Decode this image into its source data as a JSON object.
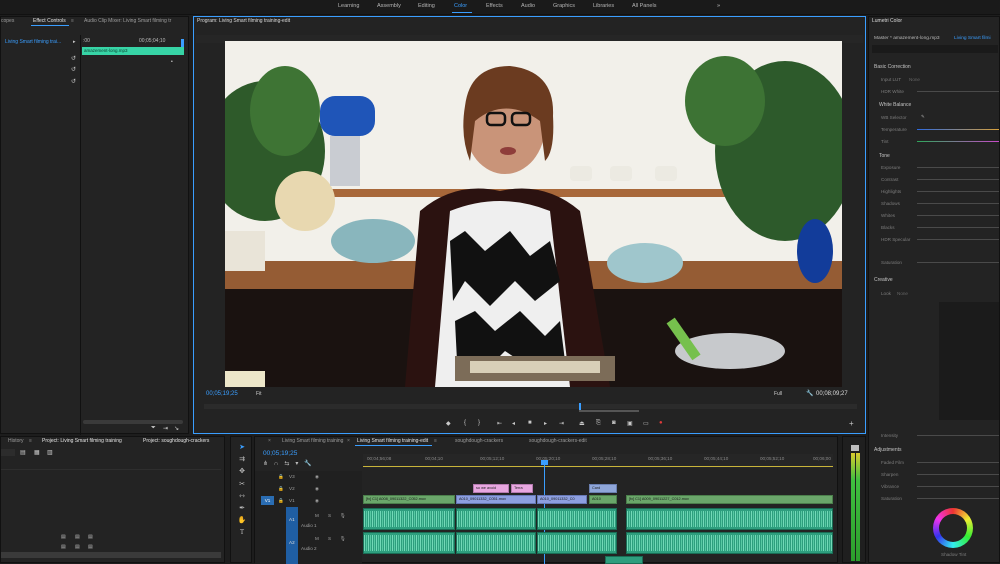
{
  "workspaces": [
    {
      "label": "Learning"
    },
    {
      "label": "Assembly"
    },
    {
      "label": "Editing"
    },
    {
      "label": "Color"
    },
    {
      "label": "Effects"
    },
    {
      "label": "Audio"
    },
    {
      "label": "Graphics"
    },
    {
      "label": "Libraries"
    },
    {
      "label": "All Panels"
    }
  ],
  "left_panel": {
    "tabs": [
      "copes",
      "Effect Controls",
      "Audio Clip Mixer: Living Smart filming tr"
    ],
    "clip_name": "Living Smart filming trai...",
    "mini_time_start": ":00",
    "mini_time_end": "00;05;04;10",
    "mini_clip": "amazement-long.mp3"
  },
  "program": {
    "title": "Program: Living Smart filming training-edit",
    "timecode": "00;05;19;25",
    "fit": "Fit",
    "quality": "Full",
    "duration": "00;08;09;27"
  },
  "lumetri": {
    "title": "Lumetri Color",
    "master": "Master * amazement-long.mp3",
    "clip": "Living Smart filmi",
    "basic": "Basic Correction",
    "input_lut": "Input LUT",
    "input_lut_val": "None",
    "hdr_white": "HDR White",
    "white_balance": "White Balance",
    "wb_selector": "WB Selector",
    "temperature": "Temperature",
    "tint": "Tint",
    "tone": "Tone",
    "exposure": "Exposure",
    "contrast": "Contrast",
    "highlights": "Highlights",
    "shadows": "Shadows",
    "whites": "Whites",
    "blacks": "Blacks",
    "hdr_specular": "HDR Specular",
    "saturation": "Saturation",
    "creative": "Creative",
    "look": "Look",
    "look_val": "None",
    "intensity": "Intensity",
    "adjustments": "Adjustments",
    "faded_film": "Faded Film",
    "sharpen": "Sharpen",
    "vibrance": "Vibrance",
    "saturation2": "Saturation",
    "shadow_tint": "Shadow Tint"
  },
  "project": {
    "tabs": [
      "History",
      "Project: Living Smart filming training",
      "Project: soughdough-crackers"
    ]
  },
  "timeline": {
    "tabs": [
      "Living Smart filming training",
      "Living Smart filming training-edit",
      "soughdough-crackers",
      "soughdough-crackers-edit"
    ],
    "timecode": "00;05;19;25",
    "ruler": [
      "00;04;56;08",
      "00;04;10",
      "00;05;12;10",
      "00;05;20;10",
      "00;05;28;10",
      "00;05;36;10",
      "00;05;44;10",
      "00;05;52;10",
      "00;06;00"
    ],
    "tracks": {
      "v3": "V3",
      "v2": "V2",
      "v1": "V1",
      "v1src": "V1",
      "a1": "A1",
      "a1name": "Audio 1",
      "a2": "A2",
      "a2name": "Audio 2"
    },
    "clips": {
      "c1": "[fx] C1] A008_09011322_C052.mov",
      "c2": "A010_09011332_C051.mov",
      "c3": "A010_09011332_C0",
      "c4": "A010",
      "c5": "[fx] C1] A009_09011227_C012.mov",
      "p1": "so we avoid",
      "p2": "Terra",
      "b1": "Card"
    }
  },
  "colors": {
    "accent": "#3a9eff",
    "video": "#6aa66a",
    "audio": "#2e9e7e",
    "title": "#e8a7e0"
  }
}
